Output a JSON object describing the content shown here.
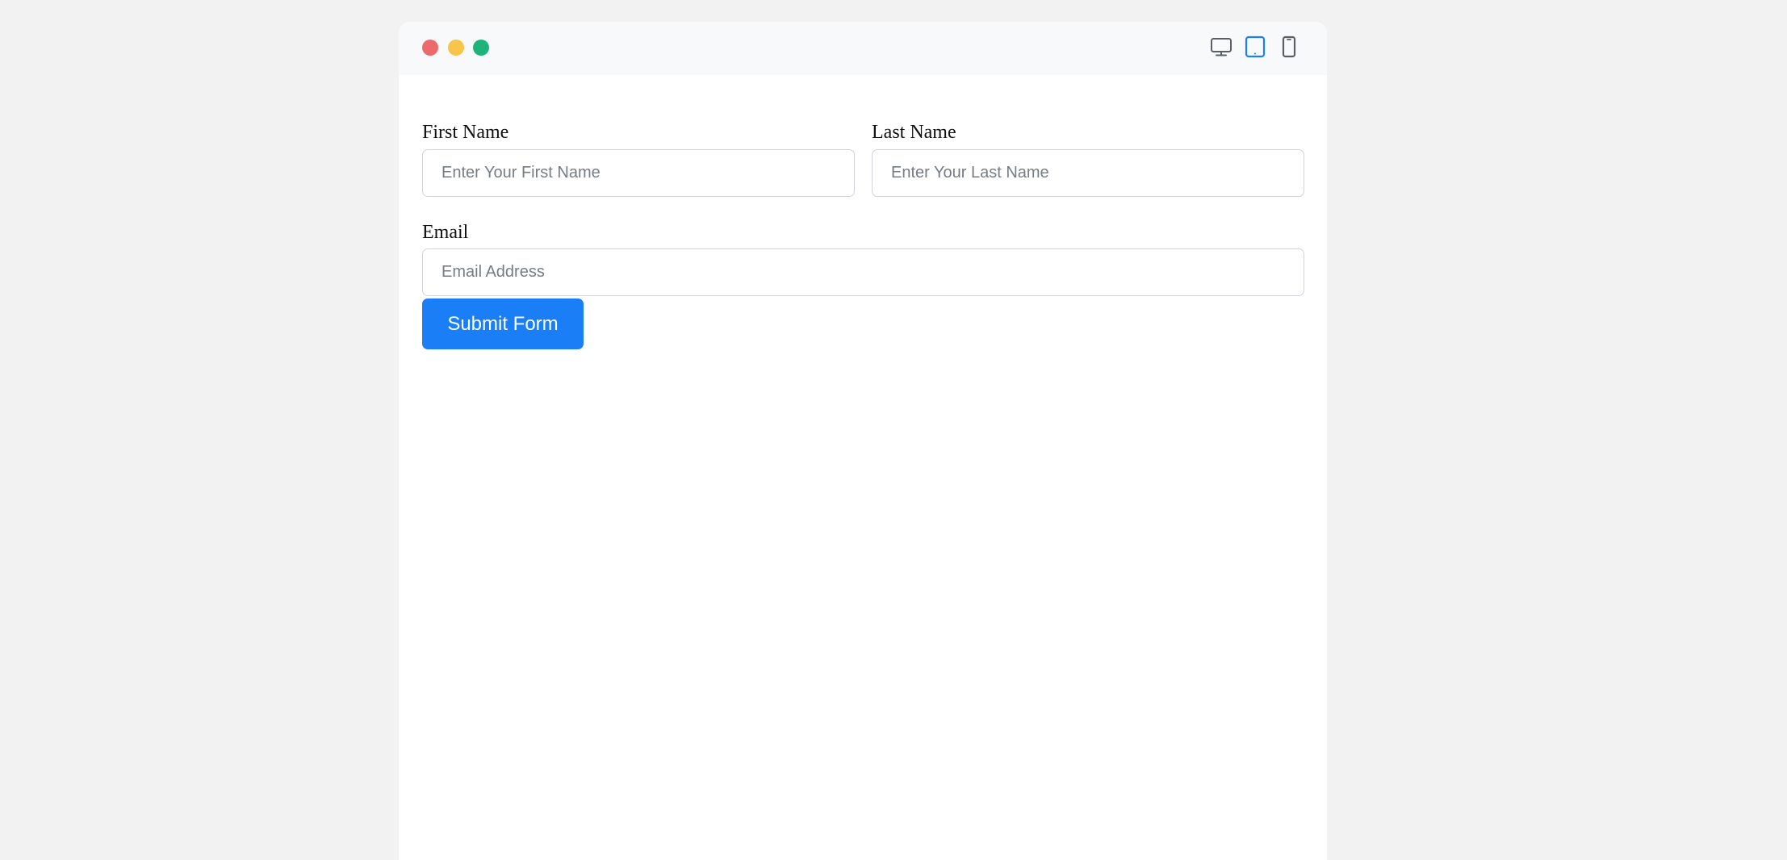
{
  "window": {
    "controls": [
      {
        "name": "close",
        "color": "#ed6a6c"
      },
      {
        "name": "minimize",
        "color": "#f7c54a"
      },
      {
        "name": "maximize",
        "color": "#1db37a"
      }
    ],
    "device_toggles": [
      {
        "name": "desktop-view",
        "icon": "monitor-icon",
        "selected": false,
        "color": "#5a5f66"
      },
      {
        "name": "tablet-view",
        "icon": "tablet-icon",
        "selected": true,
        "color": "#1a7ff7"
      },
      {
        "name": "mobile-view",
        "icon": "phone-icon",
        "selected": false,
        "color": "#5a5f66"
      }
    ]
  },
  "form": {
    "first_name": {
      "label": "First Name",
      "placeholder": "Enter Your First Name",
      "value": ""
    },
    "last_name": {
      "label": "Last Name",
      "placeholder": "Enter Your Last Name",
      "value": ""
    },
    "email": {
      "label": "Email",
      "placeholder": "Email Address",
      "value": ""
    },
    "submit_label": "Submit Form"
  },
  "colors": {
    "accent": "#1a7ff7",
    "background": "#f2f2f2",
    "titlebar": "#f8f9fa"
  }
}
